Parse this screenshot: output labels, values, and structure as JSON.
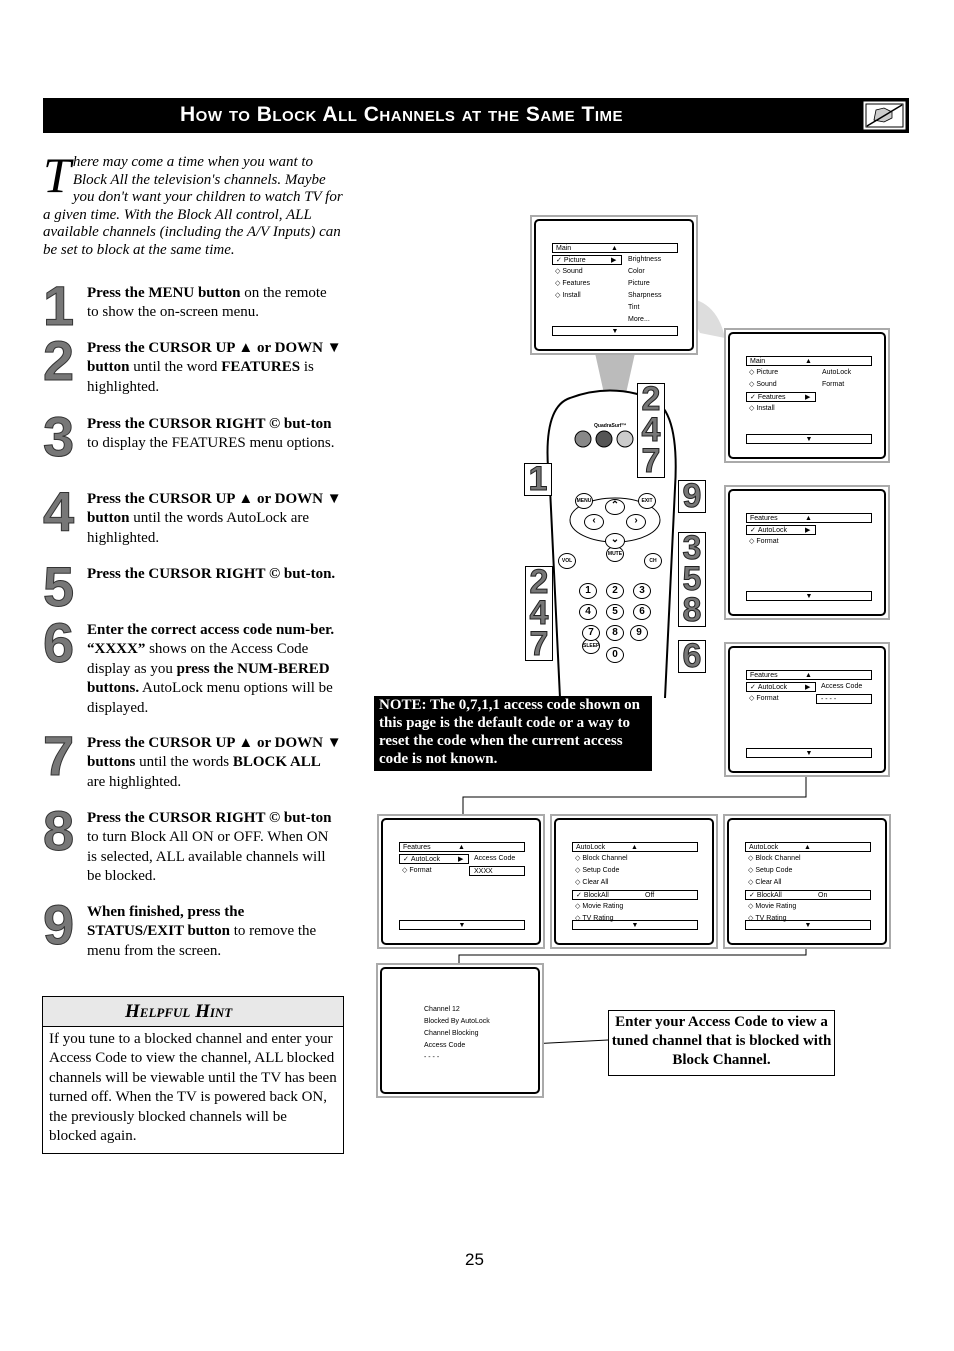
{
  "header": {
    "title": "How to Block All Channels at the Same Time",
    "icon": "no-hand-icon"
  },
  "intro": {
    "dropcap": "T",
    "text": "here may come a time when you want to Block All the television's channels. Maybe you don't want your children to watch TV for a given time. With the Block All control, ALL available channels (including the A/V Inputs) can be set to block at the same time."
  },
  "steps": [
    {
      "num": "1",
      "parts": [
        [
          "Press the MENU button",
          true
        ],
        [
          " on the remote to show the on-screen menu.",
          false
        ]
      ]
    },
    {
      "num": "2",
      "parts": [
        [
          "Press the CURSOR UP ▲ or DOWN ▼ button",
          true
        ],
        [
          " until the word ",
          false
        ],
        [
          "FEATURES",
          true
        ],
        [
          " is highlighted.",
          false
        ]
      ]
    },
    {
      "num": "3",
      "parts": [
        [
          "Press the CURSOR RIGHT © but-ton",
          true
        ],
        [
          " to display the FEATURES menu options.",
          false
        ]
      ]
    },
    {
      "num": "4",
      "parts": [
        [
          "Press the CURSOR UP ▲ or DOWN ▼ button",
          true
        ],
        [
          " until the words AutoLock are highlighted.",
          false
        ]
      ]
    },
    {
      "num": "5",
      "parts": [
        [
          "Press the CURSOR RIGHT ©  but-ton.",
          true
        ]
      ]
    },
    {
      "num": "6",
      "parts": [
        [
          "Enter the correct access code num-ber. “XXXX”",
          true
        ],
        [
          " shows on the Access Code display as you ",
          false
        ],
        [
          "press the NUM-BERED buttons.",
          true
        ],
        [
          " AutoLock menu options will be displayed.",
          false
        ]
      ]
    },
    {
      "num": "7",
      "parts": [
        [
          "Press the CURSOR UP ▲ or DOWN ▼ buttons",
          true
        ],
        [
          " until the words ",
          false
        ],
        [
          "BLOCK ALL",
          true
        ],
        [
          " are highlighted.",
          false
        ]
      ]
    },
    {
      "num": "8",
      "parts": [
        [
          "Press the CURSOR RIGHT ©  but-ton",
          true
        ],
        [
          " to turn Block All ON or OFF. When ON is selected, ALL available channels will be blocked.",
          false
        ]
      ]
    },
    {
      "num": "9",
      "parts": [
        [
          "When finished, press the STATUS/EXIT button",
          true
        ],
        [
          " to remove the menu from the screen.",
          false
        ]
      ]
    }
  ],
  "hint": {
    "title": "Helpful Hint",
    "text": "If you tune to a blocked channel and enter your Access Code to view the channel, ALL blocked channels will be viewable until the TV has been turned off. When the TV is powered back ON, the previously blocked channels will be blocked again."
  },
  "note": "NOTE: The 0,7,1,1 access code shown on this page is the default code or a way to reset the code when the current access code is not known.",
  "enter_box": "Enter your Access Code to view a tuned channel that is blocked with Block Channel.",
  "page_number": "25",
  "remote": {
    "brand_label": "QuadraSurf™",
    "buttons": [
      "MENU",
      "EXIT",
      "MUTE",
      "VOL",
      "CH",
      "SLEEP",
      "1",
      "2",
      "3",
      "4",
      "5",
      "6",
      "7",
      "8",
      "9",
      "0"
    ],
    "callouts": [
      "2\n4\n7",
      "1",
      "9",
      "3\n5\n8",
      "2\n4\n7",
      "6"
    ]
  },
  "screens": [
    {
      "header": "Main",
      "items": [
        {
          "t": "Picture",
          "m": "✓",
          "hl": true
        },
        {
          "t": "Sound",
          "m": "◇"
        },
        {
          "t": "Features",
          "m": "◇"
        },
        {
          "t": "Install",
          "m": "◇"
        }
      ],
      "side": [
        "Brightness",
        "Color",
        "Picture",
        "Sharpness",
        "Tint",
        "More..."
      ]
    },
    {
      "header": "Main",
      "items": [
        {
          "t": "Picture",
          "m": "◇"
        },
        {
          "t": "Sound",
          "m": "◇"
        },
        {
          "t": "Features",
          "m": "✓",
          "hl": true
        },
        {
          "t": "Install",
          "m": "◇"
        }
      ],
      "side": [
        "AutoLock",
        "Format"
      ]
    },
    {
      "header": "Features",
      "items": [
        {
          "t": "AutoLock",
          "m": "✓",
          "hl": true
        },
        {
          "t": "Format",
          "m": "◇"
        }
      ]
    },
    {
      "header": "Features",
      "items": [
        {
          "t": "AutoLock",
          "m": "✓",
          "hl": true
        },
        {
          "t": "Format",
          "m": "◇"
        }
      ],
      "code_label": "Access Code",
      "code_value": "- - - -"
    },
    {
      "header": "Features",
      "items": [
        {
          "t": "AutoLock",
          "m": "✓",
          "hl": true
        },
        {
          "t": "Format",
          "m": "◇"
        }
      ],
      "code_label": "Access Code",
      "code_value": "XXXX"
    },
    {
      "header": "AutoLock",
      "items": [
        {
          "t": "Block Channel",
          "m": "◇"
        },
        {
          "t": "Setup Code",
          "m": "◇"
        },
        {
          "t": "Clear All",
          "m": "◇"
        },
        {
          "t": "BlockAll",
          "m": "✓",
          "hl": true,
          "v": "Off"
        },
        {
          "t": "Movie Rating",
          "m": "◇"
        },
        {
          "t": "TV Rating",
          "m": "◇"
        }
      ],
      "wide": true
    },
    {
      "header": "AutoLock",
      "items": [
        {
          "t": "Block Channel",
          "m": "◇"
        },
        {
          "t": "Setup Code",
          "m": "◇"
        },
        {
          "t": "Clear All",
          "m": "◇"
        },
        {
          "t": "BlockAll",
          "m": "✓",
          "hl": true,
          "v": "On"
        },
        {
          "t": "Movie Rating",
          "m": "◇"
        },
        {
          "t": "TV Rating",
          "m": "◇"
        }
      ],
      "wide": true
    },
    {
      "lines": [
        "Channel 12",
        "Blocked By AutoLock",
        "Channel Blocking",
        "Access Code",
        "- - - -"
      ]
    }
  ]
}
